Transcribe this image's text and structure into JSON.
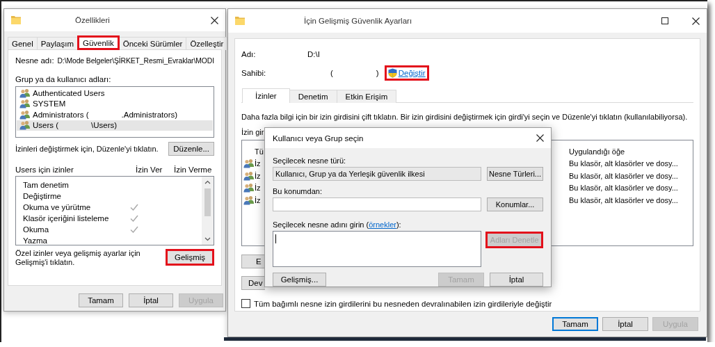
{
  "properties_window": {
    "title": "Özellikleri",
    "tabs": [
      {
        "label": "Genel",
        "selected": false,
        "highlighted": false
      },
      {
        "label": "Paylaşım",
        "selected": false,
        "highlighted": false
      },
      {
        "label": "Güvenlik",
        "selected": true,
        "highlighted": true
      },
      {
        "label": "Önceki Sürümler",
        "selected": false,
        "highlighted": false
      },
      {
        "label": "Özelleştir",
        "selected": false,
        "highlighted": false
      }
    ],
    "object_name_label": "Nesne adı:",
    "object_name": "D:\\Mode Belgeler\\ŞİRKET_Resmi_Evraklar\\MODI",
    "groups_label": "Grup ya da kullanıcı adları:",
    "groups": [
      {
        "name_parts": [
          "Authenticated Users"
        ],
        "selected": false
      },
      {
        "name_parts": [
          "SYSTEM"
        ],
        "selected": false
      },
      {
        "name_parts": [
          "Administrators (",
          ".Administrators)"
        ],
        "selected": false
      },
      {
        "name_parts": [
          "Users (",
          "\\Users)"
        ],
        "selected": true
      }
    ],
    "edit_hint": "İzinleri değiştirmek için, Düzenle'yi tıklatın.",
    "edit_button": {
      "label": "Düzenle...",
      "highlighted": false
    },
    "permissions_header": {
      "title": "Users için izinler",
      "allow": "İzin Ver",
      "deny": "İzin Verme"
    },
    "permissions": [
      {
        "label": "Tam denetim",
        "allow": false
      },
      {
        "label": "Değiştirme",
        "allow": false
      },
      {
        "label": "Okuma ve yürütme",
        "allow": true
      },
      {
        "label": "Klasör içeriğini listeleme",
        "allow": true
      },
      {
        "label": "Okuma",
        "allow": true
      },
      {
        "label": "Yazma",
        "allow": false
      }
    ],
    "advanced_hint": "Özel izinler veya gelişmiş ayarlar için Gelişmiş'i tıklatın.",
    "advanced_button": {
      "label": "Gelişmiş",
      "highlighted": true
    },
    "buttons": [
      {
        "label": "Tamam",
        "disabled": false,
        "default": false
      },
      {
        "label": "İptal",
        "disabled": false,
        "default": false
      },
      {
        "label": "Uygula",
        "disabled": true,
        "default": false
      }
    ]
  },
  "advanced_window": {
    "title": "İçin Gelişmiş Güvenlik Ayarları",
    "name_label": "Adı:",
    "name": "D:\\I",
    "owner_label": "Sahibi:",
    "owner_parts": [
      "(",
      ")"
    ],
    "change_link": {
      "label": "Değiştir",
      "highlighted": true
    },
    "tabs": [
      {
        "label": "İzinler",
        "selected": true
      },
      {
        "label": "Denetim",
        "selected": false
      },
      {
        "label": "Etkin Erişim",
        "selected": false
      }
    ],
    "description": "Daha fazla bilgi için bir izin girdisini çift tıklatın. Bir izin girdisini değiştirmek için girdi'yi seçin ve Düzenle'yi tıklatın (kullanılabiliyorsa).",
    "entries_label": "İzin gir",
    "columns": [
      "Tü",
      "Uygulandığı öğe"
    ],
    "entries": [
      {
        "name": "İz",
        "applies_to": "Bu klasör, alt klasörler ve dosy..."
      },
      {
        "name": "İz",
        "applies_to": "Bu klasör, alt klasörler ve dosy..."
      },
      {
        "name": "İz",
        "applies_to": "Bu klasör, alt klasörler ve dosy..."
      },
      {
        "name": "İz",
        "applies_to": "Bu klasör, alt klasörler ve dosy..."
      }
    ],
    "side_buttons": [
      "E",
      "Dev"
    ],
    "replace_checkbox": {
      "label": "Tüm bağımlı nesne izin girdilerini bu nesneden devralınabilen izin girdileriyle değiştir",
      "checked": false
    },
    "buttons": [
      {
        "label": "Tamam",
        "disabled": false,
        "default": true
      },
      {
        "label": "İptal",
        "disabled": false,
        "default": false
      },
      {
        "label": "Uygula",
        "disabled": true,
        "default": false
      }
    ]
  },
  "picker_window": {
    "title": "Kullanıcı veya Grup seçin",
    "object_type_label": "Seçilecek nesne türü:",
    "object_type": "Kullanıcı, Grup ya da Yerleşik güvenlik ilkesi",
    "object_types_button": {
      "label": "Nesne Türleri...",
      "disabled": false,
      "highlighted": false
    },
    "location_label": "Bu konumdan:",
    "locations_button": {
      "label": "Konumlar...",
      "disabled": false,
      "highlighted": false
    },
    "names_label": {
      "before": "Seçilecek nesne adını girin (",
      "link": "örnekler",
      "after": "):"
    },
    "check_names_button": {
      "label": "Adları Denetle",
      "disabled": true,
      "highlighted": true
    },
    "buttons": [
      {
        "label": "Gelişmiş...",
        "disabled": false,
        "default": false
      },
      {
        "label": "Tamam",
        "disabled": true,
        "default": false
      },
      {
        "label": "İptal",
        "disabled": false,
        "default": false
      }
    ]
  }
}
